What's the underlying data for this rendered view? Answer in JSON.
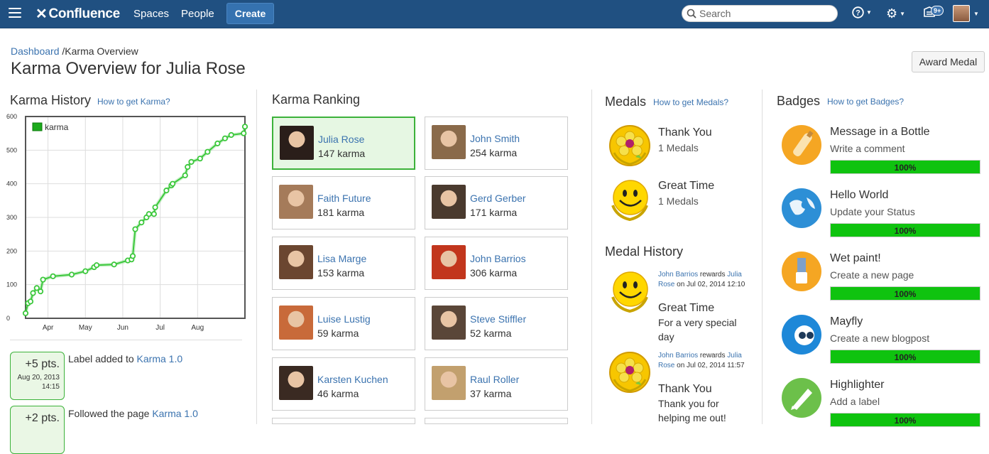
{
  "header": {
    "app_name": "Confluence",
    "nav": [
      "Spaces",
      "People"
    ],
    "create_label": "Create",
    "search_placeholder": "Search",
    "notif_count": "9+"
  },
  "breadcrumb": {
    "root": "Dashboard",
    "sep": "/",
    "current": "Karma Overview"
  },
  "page_title": "Karma Overview for Julia Rose",
  "award_button": "Award Medal",
  "karma_history": {
    "title": "Karma History",
    "help_link": "How to get Karma?",
    "events": [
      {
        "pts": "+5 pts.",
        "date": "Aug 20, 2013 14:15",
        "text": "Label added to",
        "link": "Karma 1.0"
      },
      {
        "pts": "+2 pts.",
        "date": "",
        "text": "Followed the page",
        "link": "Karma 1.0"
      }
    ]
  },
  "chart_data": {
    "type": "line",
    "series": [
      {
        "name": "karma",
        "x": [
          0,
          2,
          4,
          6,
          9,
          12,
          14,
          22,
          37,
          48,
          55,
          57,
          71,
          82,
          85,
          86,
          88,
          93,
          97,
          99,
          103,
          104,
          113,
          117,
          118,
          128,
          130,
          133,
          140,
          146,
          154,
          160,
          165,
          175,
          176
        ],
        "y": [
          15,
          45,
          50,
          75,
          90,
          80,
          115,
          125,
          130,
          140,
          152,
          158,
          160,
          172,
          175,
          185,
          265,
          285,
          300,
          310,
          310,
          330,
          380,
          395,
          400,
          425,
          450,
          465,
          475,
          495,
          520,
          535,
          545,
          550,
          570
        ]
      }
    ],
    "ylim": [
      0,
      600
    ],
    "yticks": [
      0,
      100,
      200,
      300,
      400,
      500,
      600
    ],
    "xticks": [
      {
        "label": "Apr",
        "x": 18
      },
      {
        "label": "May",
        "x": 48
      },
      {
        "label": "Jun",
        "x": 78
      },
      {
        "label": "Jul",
        "x": 108
      },
      {
        "label": "Aug",
        "x": 138
      }
    ],
    "xlim": [
      0,
      176
    ],
    "legend": "top-left",
    "grid": true,
    "color": "#3cc83c"
  },
  "ranking": {
    "title": "Karma Ranking",
    "people": [
      {
        "name": "Julia Rose",
        "karma": "147 karma",
        "active": true,
        "av": "#2a1e1a"
      },
      {
        "name": "John Smith",
        "karma": "254 karma",
        "active": false,
        "av": "#8a6a4a"
      },
      {
        "name": "Faith Future",
        "karma": "181 karma",
        "active": false,
        "av": "#a57b5a"
      },
      {
        "name": "Gerd Gerber",
        "karma": "171 karma",
        "active": false,
        "av": "#4a3a2e"
      },
      {
        "name": "Lisa Marge",
        "karma": "153 karma",
        "active": false,
        "av": "#6b4630"
      },
      {
        "name": "John Barrios",
        "karma": "306 karma",
        "active": false,
        "av": "#c2361d"
      },
      {
        "name": "Luise Lustig",
        "karma": "59 karma",
        "active": false,
        "av": "#c86a3a"
      },
      {
        "name": "Steve Stiffler",
        "karma": "52 karma",
        "active": false,
        "av": "#5a4638"
      },
      {
        "name": "Karsten Kuchen",
        "karma": "46 karma",
        "active": false,
        "av": "#3a2a22"
      },
      {
        "name": "Raul Roller",
        "karma": "37 karma",
        "active": false,
        "av": "#c2a06e"
      }
    ]
  },
  "medals": {
    "title": "Medals",
    "help_link": "How to get Medals?",
    "items": [
      {
        "name": "Thank You",
        "count": "1 Medals",
        "icon": "flower-medal-icon"
      },
      {
        "name": "Great Time",
        "count": "1 Medals",
        "icon": "smiley-medal-icon"
      }
    ]
  },
  "medal_history": {
    "title": "Medal History",
    "items": [
      {
        "giver": "John Barrios",
        "verb": "rewards",
        "receiver": "Julia Rose",
        "date": "on Jul 02, 2014 12:10",
        "medal": "Great Time",
        "note": "For a very special day",
        "icon": "smiley-medal-icon"
      },
      {
        "giver": "John Barrios",
        "verb": "rewards",
        "receiver": "Julia Rose",
        "date": "on Jul 02, 2014 11:57",
        "medal": "Thank You",
        "note": "Thank you for helping me out!",
        "icon": "flower-medal-icon"
      }
    ]
  },
  "badges": {
    "title": "Badges",
    "help_link": "How to get Badges?",
    "items": [
      {
        "name": "Message in a Bottle",
        "desc": "Write a comment",
        "pct": "100%",
        "progress": 1.0,
        "icon": "bottle-icon",
        "color": "#f5a623"
      },
      {
        "name": "Hello World",
        "desc": "Update your Status",
        "pct": "100%",
        "progress": 1.0,
        "icon": "globe-icon",
        "color": "#2d8fd6"
      },
      {
        "name": "Wet paint!",
        "desc": "Create a new page",
        "pct": "100%",
        "progress": 1.0,
        "icon": "paintbrush-icon",
        "color": "#f5a623"
      },
      {
        "name": "Mayfly",
        "desc": "Create a new blogpost",
        "pct": "100%",
        "progress": 1.0,
        "icon": "mayfly-icon",
        "color": "#1e88d8"
      },
      {
        "name": "Highlighter",
        "desc": "Add a label",
        "pct": "100%",
        "progress": 1.0,
        "icon": "highlighter-icon",
        "color": "#6cc04a"
      }
    ]
  }
}
